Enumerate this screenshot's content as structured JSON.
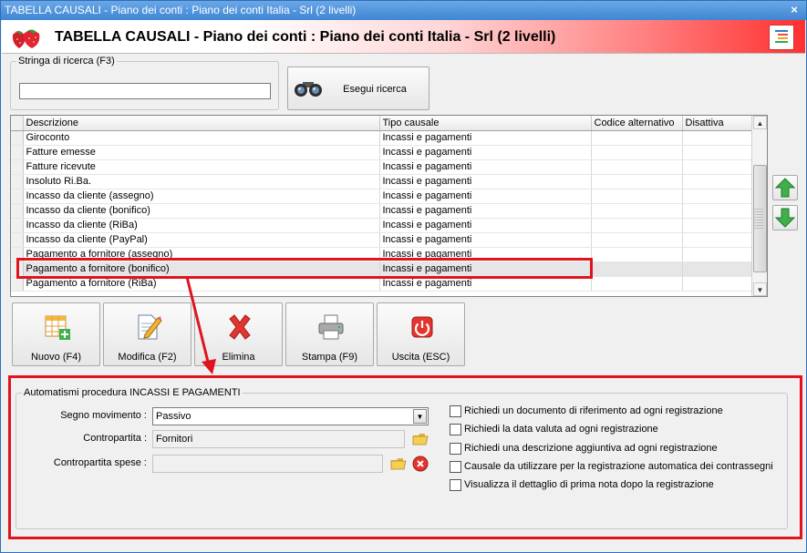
{
  "window": {
    "title": "TABELLA CAUSALI - Piano dei conti : Piano dei conti Italia - Srl (2 livelli)",
    "close_glyph": "×"
  },
  "header": {
    "title": "TABELLA CAUSALI - Piano dei conti : Piano dei conti Italia - Srl (2 livelli)"
  },
  "search": {
    "legend": "Stringa di ricerca (F3)",
    "value": "",
    "button_label": "Esegui ricerca",
    "icon": "binoculars-icon"
  },
  "grid": {
    "columns": [
      "Descrizione",
      "Tipo causale",
      "Codice alternativo",
      "Disattiva"
    ],
    "rows": [
      {
        "desc": "Giroconto",
        "tipo": "Incassi e pagamenti"
      },
      {
        "desc": "Fatture emesse",
        "tipo": "Incassi e pagamenti"
      },
      {
        "desc": "Fatture ricevute",
        "tipo": "Incassi e pagamenti"
      },
      {
        "desc": "Insoluto Ri.Ba.",
        "tipo": "Incassi e pagamenti"
      },
      {
        "desc": "Incasso da cliente (assegno)",
        "tipo": "Incassi e pagamenti"
      },
      {
        "desc": "Incasso da cliente (bonifico)",
        "tipo": "Incassi e pagamenti"
      },
      {
        "desc": "Incasso da cliente (RiBa)",
        "tipo": "Incassi e pagamenti"
      },
      {
        "desc": "Incasso da cliente (PayPal)",
        "tipo": "Incassi e pagamenti"
      },
      {
        "desc": "Pagamento a fornitore (assegno)",
        "tipo": "Incassi e pagamenti"
      },
      {
        "desc": "Pagamento a fornitore (bonifico)",
        "tipo": "Incassi e pagamenti"
      },
      {
        "desc": "Pagamento a fornitore (RiBa)",
        "tipo": "Incassi e pagamenti"
      }
    ],
    "selected_index": 9
  },
  "toolbar": {
    "new_label": "Nuovo (F4)",
    "edit_label": "Modifica (F2)",
    "delete_label": "Elimina",
    "print_label": "Stampa (F9)",
    "exit_label": "Uscita (ESC)"
  },
  "automatismi": {
    "legend": "Automatismi procedura INCASSI E PAGAMENTI",
    "segno_label": "Segno movimento :",
    "segno_value": "Passivo",
    "contropartita_label": "Contropartita :",
    "contropartita_value": "Fornitori",
    "spese_label": "Contropartita spese :",
    "spese_value": "",
    "checks": [
      {
        "label": "Richiedi un documento di riferimento ad ogni registrazione",
        "checked": false
      },
      {
        "label": "Richiedi la data valuta ad ogni registrazione",
        "checked": false
      },
      {
        "label": "Richiedi una descrizione aggiuntiva ad ogni registrazione",
        "checked": false
      },
      {
        "label": "Causale da utilizzare per la registrazione automatica dei contrassegni",
        "checked": false
      },
      {
        "label": "Visualizza il dettaglio di prima nota dopo la registrazione",
        "checked": false
      }
    ]
  },
  "colors": {
    "accent_red": "#e0141e",
    "titlebar_blue": "#3f86d4"
  }
}
